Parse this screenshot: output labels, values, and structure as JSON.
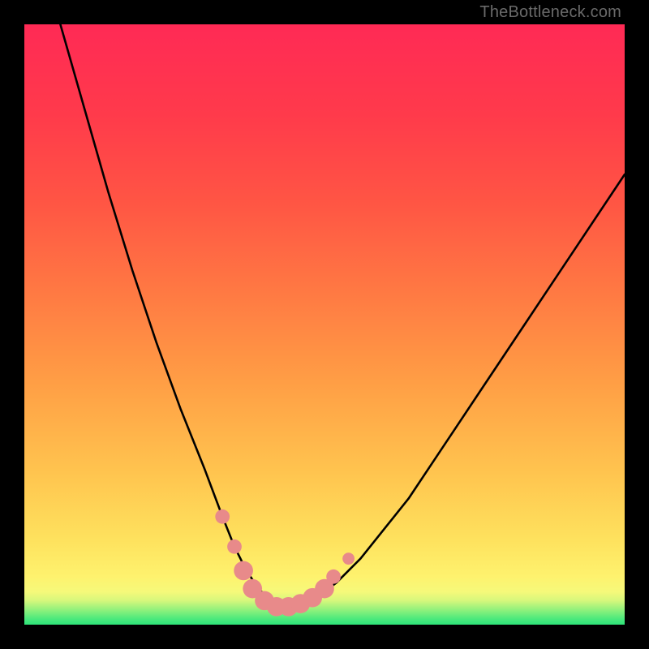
{
  "watermark": "TheBottleneck.com",
  "chart_data": {
    "type": "line",
    "title": "",
    "xlabel": "",
    "ylabel": "",
    "xlim": [
      0,
      100
    ],
    "ylim": [
      0,
      100
    ],
    "grid": false,
    "legend": null,
    "series": [
      {
        "name": "bottleneck-curve",
        "x": [
          6,
          10,
          14,
          18,
          22,
          26,
          30,
          33,
          35,
          37,
          39,
          41,
          43,
          45,
          48,
          52,
          56,
          60,
          64,
          68,
          72,
          76,
          80,
          84,
          88,
          92,
          96,
          100
        ],
        "y": [
          100,
          86,
          72,
          59,
          47,
          36,
          26,
          18,
          13,
          9,
          6,
          4,
          3,
          3,
          4,
          7,
          11,
          16,
          21,
          27,
          33,
          39,
          45,
          51,
          57,
          63,
          69,
          75
        ]
      }
    ],
    "markers": {
      "name": "highlighted-points",
      "color": "#e88a8a",
      "points": [
        {
          "x": 33,
          "y": 18,
          "r": 1.2
        },
        {
          "x": 35,
          "y": 13,
          "r": 1.2
        },
        {
          "x": 36.5,
          "y": 9,
          "r": 1.6
        },
        {
          "x": 38,
          "y": 6,
          "r": 1.6
        },
        {
          "x": 40,
          "y": 4,
          "r": 1.6
        },
        {
          "x": 42,
          "y": 3,
          "r": 1.6
        },
        {
          "x": 44,
          "y": 3,
          "r": 1.6
        },
        {
          "x": 46,
          "y": 3.5,
          "r": 1.6
        },
        {
          "x": 48,
          "y": 4.5,
          "r": 1.6
        },
        {
          "x": 50,
          "y": 6,
          "r": 1.6
        },
        {
          "x": 51.5,
          "y": 8,
          "r": 1.2
        },
        {
          "x": 54,
          "y": 11,
          "r": 1.0
        }
      ]
    },
    "background_bands": [
      {
        "y": 0.0,
        "color": "#2ee47a"
      },
      {
        "y": 1.0,
        "color": "#4de97c"
      },
      {
        "y": 2.0,
        "color": "#7bef7c"
      },
      {
        "y": 3.0,
        "color": "#a8f37c"
      },
      {
        "y": 4.0,
        "color": "#d6f77c"
      },
      {
        "y": 5.5,
        "color": "#f6f97a"
      },
      {
        "y": 8.0,
        "color": "#fef26e"
      },
      {
        "y": 14.0,
        "color": "#fee25e"
      },
      {
        "y": 25.0,
        "color": "#ffc54f"
      },
      {
        "y": 40.0,
        "color": "#ff9f45"
      },
      {
        "y": 55.0,
        "color": "#ff7a43"
      },
      {
        "y": 70.0,
        "color": "#ff5644"
      },
      {
        "y": 85.0,
        "color": "#ff3a4b"
      },
      {
        "y": 100.0,
        "color": "#ff2a55"
      }
    ]
  }
}
